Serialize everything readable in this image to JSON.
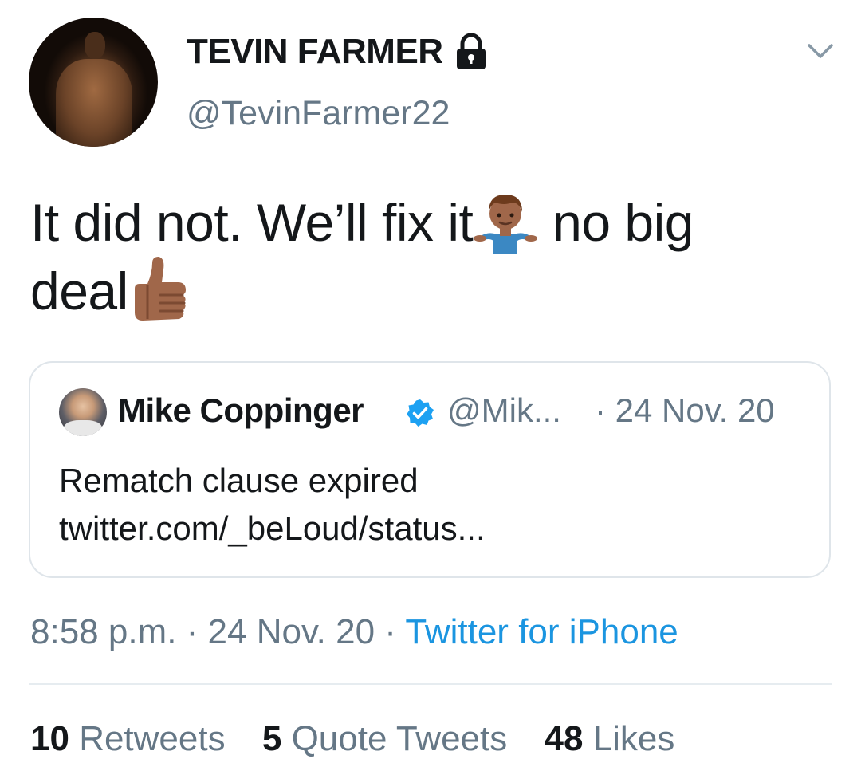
{
  "tweet": {
    "author_name": "TEVIN FARMER",
    "author_handle": "@TevinFarmer22",
    "text_part1": "It did not. We’ll fix it",
    "text_part2": " no big",
    "text_part3": "deal",
    "emoji_1": "man-shrugging-emoji",
    "emoji_2": "thumbs-up-emoji"
  },
  "quote": {
    "author_name": "Mike Coppinger",
    "author_handle": "@Mik...",
    "date": "· 24 Nov. 20",
    "text": "Rematch clause expired twitter.com/_beLoud/status..."
  },
  "meta": {
    "time_date": "8:58 p.m. · 24 Nov. 20 · ",
    "source": "Twitter for iPhone"
  },
  "stats": {
    "retweets_count": "10",
    "retweets_label": "Retweets",
    "quotes_count": "5",
    "quotes_label": "Quote Tweets",
    "likes_count": "48",
    "likes_label": "Likes"
  },
  "colors": {
    "text": "#14171a",
    "secondary": "#657786",
    "link": "#1b95e0",
    "verified": "#1da1f2"
  }
}
